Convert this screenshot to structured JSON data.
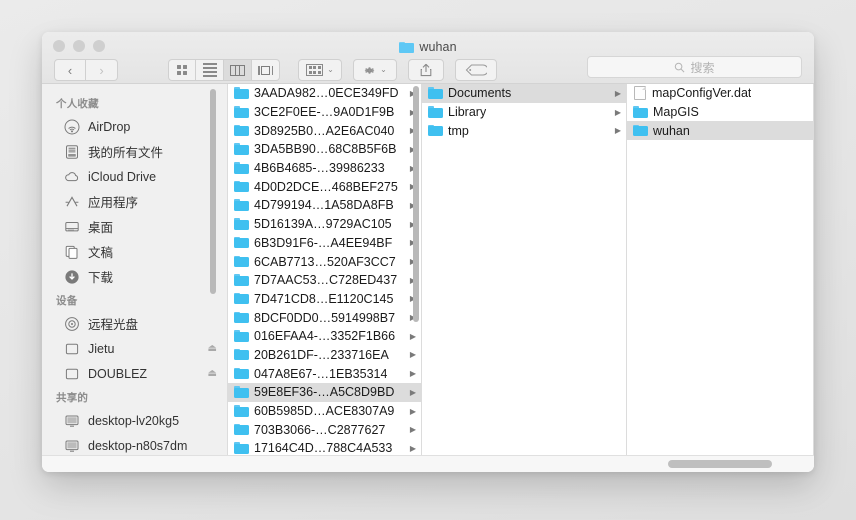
{
  "window": {
    "title": "wuhan",
    "title_icon": "folder-icon",
    "traffic_lights": [
      "close-button",
      "minimize-button",
      "zoom-button"
    ]
  },
  "toolbar": {
    "back_label": "‹",
    "forward_label": "›",
    "view_buttons": [
      {
        "name": "icon-view",
        "active": false
      },
      {
        "name": "list-view",
        "active": false
      },
      {
        "name": "column-view",
        "active": true
      },
      {
        "name": "coverflow-view",
        "active": false
      }
    ],
    "arrange_label": "",
    "action_label": "",
    "share_label": "",
    "tag_label": "",
    "chevron": "⌄"
  },
  "search": {
    "placeholder": "搜索",
    "value": "",
    "icon": "search-icon"
  },
  "sidebar": {
    "sections": [
      {
        "header": "个人收藏",
        "items": [
          {
            "label": "AirDrop",
            "icon": "airdrop-icon"
          },
          {
            "label": "我的所有文件",
            "icon": "all-files-icon"
          },
          {
            "label": "iCloud Drive",
            "icon": "icloud-icon"
          },
          {
            "label": "应用程序",
            "icon": "applications-icon"
          },
          {
            "label": "桌面",
            "icon": "desktop-icon"
          },
          {
            "label": "文稿",
            "icon": "documents-icon"
          },
          {
            "label": "下载",
            "icon": "downloads-icon"
          }
        ]
      },
      {
        "header": "设备",
        "items": [
          {
            "label": "远程光盘",
            "icon": "remote-disc-icon",
            "eject": false
          },
          {
            "label": "Jietu",
            "icon": "hard-disk-icon",
            "eject": true
          },
          {
            "label": "DOUBLEZ",
            "icon": "hard-disk-icon",
            "eject": true
          }
        ]
      },
      {
        "header": "共享的",
        "items": [
          {
            "label": "desktop-lv20kg5",
            "icon": "computer-icon",
            "eject": false
          },
          {
            "label": "desktop-n80s7dm",
            "icon": "computer-icon",
            "eject": false
          }
        ]
      }
    ]
  },
  "columns": [
    {
      "name": "column-1",
      "items": [
        {
          "label": "3AADA982…0ECE349FD",
          "type": "folder",
          "selected": false
        },
        {
          "label": "3CE2F0EE-…9A0D1F9B",
          "type": "folder",
          "selected": false
        },
        {
          "label": "3D8925B0…A2E6AC040",
          "type": "folder",
          "selected": false
        },
        {
          "label": "3DA5BB90…68C8B5F6B",
          "type": "folder",
          "selected": false
        },
        {
          "label": "4B6B4685-…39986233",
          "type": "folder",
          "selected": false
        },
        {
          "label": "4D0D2DCE…468BEF275",
          "type": "folder",
          "selected": false
        },
        {
          "label": "4D799194…1A58DA8FB",
          "type": "folder",
          "selected": false
        },
        {
          "label": "5D16139A…9729AC105",
          "type": "folder",
          "selected": false
        },
        {
          "label": "6B3D91F6-…A4EE94BF",
          "type": "folder",
          "selected": false
        },
        {
          "label": "6CAB7713…520AF3CC7",
          "type": "folder",
          "selected": false
        },
        {
          "label": "7D7AAC53…C728ED437",
          "type": "folder",
          "selected": false
        },
        {
          "label": "7D471CD8…E1120C145",
          "type": "folder",
          "selected": false
        },
        {
          "label": "8DCF0DD0…5914998B7",
          "type": "folder",
          "selected": false
        },
        {
          "label": "016EFAA4-…3352F1B66",
          "type": "folder",
          "selected": false
        },
        {
          "label": "20B261DF-…233716EA",
          "type": "folder",
          "selected": false
        },
        {
          "label": "047A8E67-…1EB35314",
          "type": "folder",
          "selected": false
        },
        {
          "label": "59E8EF36-…A5C8D9BD",
          "type": "folder",
          "selected": true
        },
        {
          "label": "60B5985D…ACE8307A9",
          "type": "folder",
          "selected": false
        },
        {
          "label": "703B3066-…C2877627",
          "type": "folder",
          "selected": false
        },
        {
          "label": "17164C4D…788C4A533",
          "type": "folder",
          "selected": false
        },
        {
          "label": "",
          "type": "folder",
          "selected": false
        }
      ]
    },
    {
      "name": "column-2",
      "items": [
        {
          "label": "Documents",
          "type": "folder",
          "selected": true
        },
        {
          "label": "Library",
          "type": "folder",
          "selected": false
        },
        {
          "label": "tmp",
          "type": "folder",
          "selected": false
        }
      ]
    },
    {
      "name": "column-3",
      "items": [
        {
          "label": "mapConfigVer.dat",
          "type": "file",
          "selected": false
        },
        {
          "label": "MapGIS",
          "type": "folder",
          "selected": false
        },
        {
          "label": "wuhan",
          "type": "folder",
          "selected": true
        }
      ]
    }
  ],
  "colors": {
    "folder": "#3fc0f0",
    "selection": "#dcdcdc",
    "titlebar": "#e8e8e8",
    "sidebar": "#f0f0f0"
  },
  "disclosure_glyph": "▶",
  "grip_glyph": "‖"
}
